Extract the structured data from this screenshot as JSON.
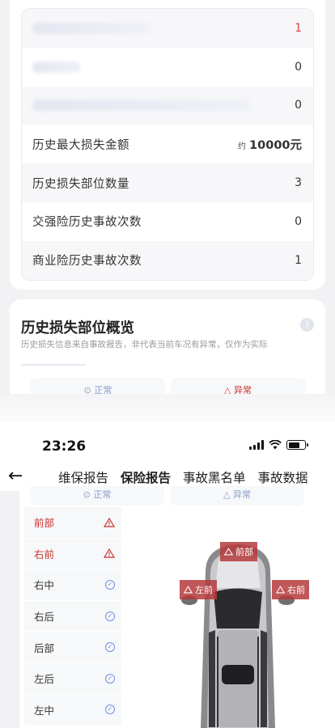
{
  "stats": {
    "rows": [
      {
        "label": "",
        "value": "1",
        "value_color": "red",
        "blurred": true
      },
      {
        "label": "",
        "value": "0",
        "blurred": true
      },
      {
        "label": "",
        "value": "0",
        "blurred": true
      },
      {
        "label": "历史最大损失金额",
        "approx": "约",
        "value": "10000元"
      },
      {
        "label": "历史损失部位数量",
        "value": "3"
      },
      {
        "label": "交强险历史事故次数",
        "value": "0"
      },
      {
        "label": "商业险历史事故次数",
        "value": "1"
      }
    ]
  },
  "overview": {
    "title": "历史损失部位概览",
    "subtitle": "历史损失信息来自事故报告，非代表当前车况有异常，仅作为实际",
    "legend_normal": "正常",
    "legend_abnormal": "异常"
  },
  "status_bar": {
    "time": "23:26"
  },
  "nav": {
    "back": "←",
    "tabs": [
      {
        "label": "维保报告",
        "active": false
      },
      {
        "label": "保险报告",
        "active": true
      },
      {
        "label": "事故黑名单",
        "active": false
      },
      {
        "label": "事故数据",
        "active": false
      }
    ]
  },
  "damage": {
    "legend_normal": "正常",
    "legend_abnormal": "异常",
    "parts": [
      {
        "name": "前部",
        "status": "abnormal"
      },
      {
        "name": "右前",
        "status": "abnormal"
      },
      {
        "name": "右中",
        "status": "normal"
      },
      {
        "name": "右后",
        "status": "normal"
      },
      {
        "name": "后部",
        "status": "normal"
      },
      {
        "name": "左后",
        "status": "normal"
      },
      {
        "name": "左中",
        "status": "normal"
      }
    ],
    "car_tags": {
      "front": "前部",
      "left_front": "左前",
      "right_front": "右前"
    }
  },
  "colors": {
    "accent": "#e8a24a",
    "damage_red": "#c8332d",
    "normal_blue": "#6e8fe0"
  }
}
